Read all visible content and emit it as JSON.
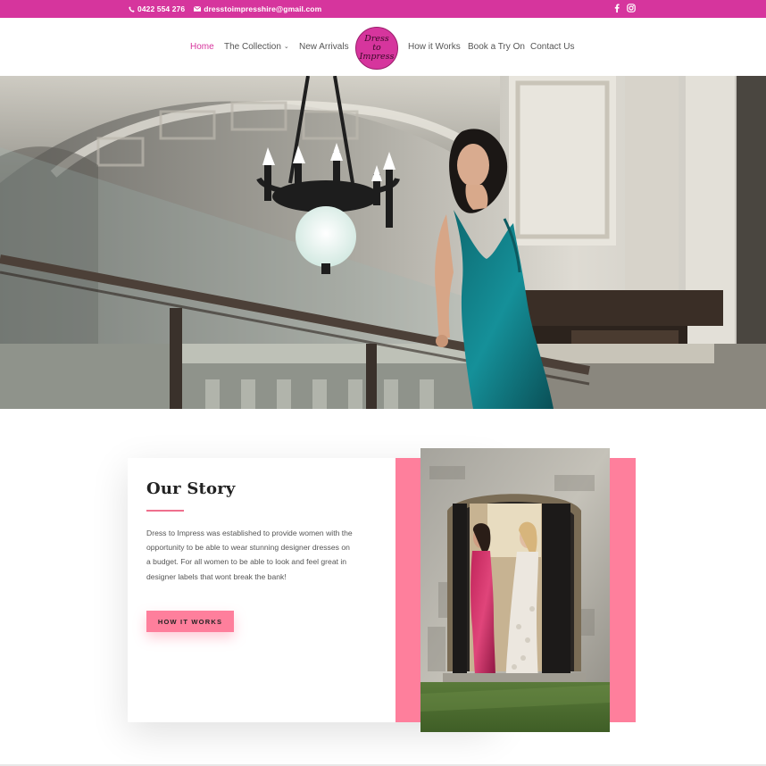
{
  "topbar": {
    "phone": "0422 554 276",
    "email": "dresstoimpresshire@gmail.com",
    "social": [
      "facebook-icon",
      "instagram-icon"
    ],
    "color": "#d6359d"
  },
  "nav": {
    "items": [
      {
        "label": "Home",
        "active": true
      },
      {
        "label": "The Collection",
        "dropdown": true
      },
      {
        "label": "New Arrivals"
      },
      {
        "label": "How it Works"
      },
      {
        "label": "Book a Try On"
      },
      {
        "label": "Contact Us"
      }
    ],
    "logo_text": "Dress to Impress"
  },
  "story": {
    "title": "Our Story",
    "body": "Dress to Impress was established to provide women with the opportunity to be able to wear stunning designer dresses on a budget. For all women to be able to look and feel great in designer labels that wont break the bank!",
    "button_label": "HOW IT WORKS",
    "accent_color": "#fe7f9c"
  }
}
